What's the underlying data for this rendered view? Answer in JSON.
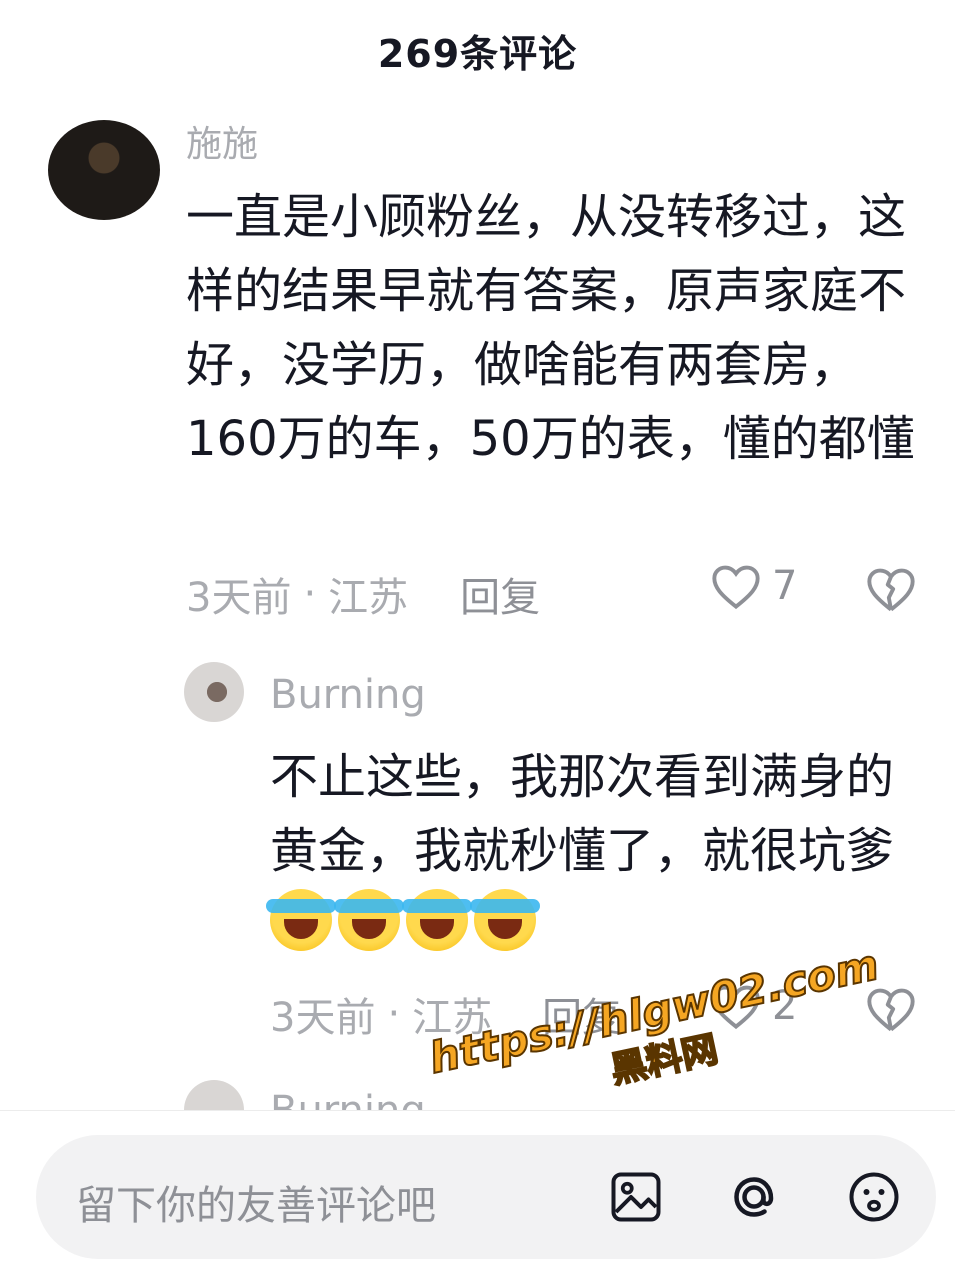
{
  "header": {
    "title": "269条评论"
  },
  "comments": [
    {
      "username": "施施",
      "text": "一直是小顾粉丝，从没转移过，这样的结果早就有答案，原声家庭不好，没学历，做啥能有两套房，160万的车，50万的表，懂的都懂",
      "time": "3天前",
      "location": "江苏",
      "reply_label": "回复",
      "likes": "7"
    },
    {
      "username": "Burning",
      "text": "不止这些，我那次看到满身的黄金，我就秒懂了，就很坑爹",
      "emojis": [
        "crying-laughing-emoji",
        "crying-laughing-emoji",
        "crying-laughing-emoji",
        "crying-laughing-emoji"
      ],
      "time": "3天前",
      "location": "江苏",
      "reply_label": "回复",
      "likes": "2"
    },
    {
      "username": "Burning"
    }
  ],
  "input": {
    "placeholder": "留下你的友善评论吧"
  },
  "watermark": {
    "url": "https://hlgw02.com",
    "name": "黑料网"
  },
  "colors": {
    "text": "#161823",
    "secondary": "#a9abb0",
    "input_bg": "#f2f2f3",
    "watermark": "#f5a623"
  }
}
